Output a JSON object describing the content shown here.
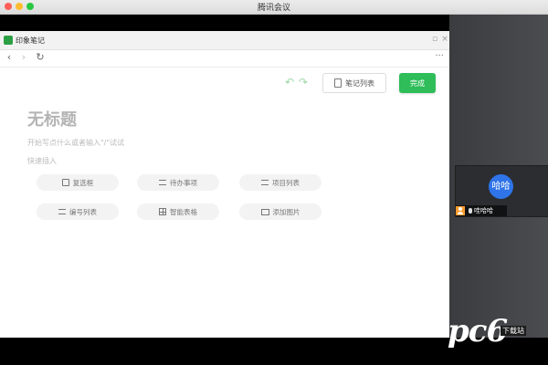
{
  "window": {
    "title": "腾讯会议"
  },
  "note_app": {
    "title": "印象笔记",
    "toolbar": {
      "note_list_label": "笔记列表",
      "done_label": "完成"
    },
    "editor": {
      "title_placeholder": "无标题",
      "body_placeholder": "开始写点什么或者输入\"/\"试试",
      "quick_insert_label": "快速插入",
      "quick_items": [
        {
          "label": "复选框",
          "icon": "checkbox-icon"
        },
        {
          "label": "待办事项",
          "icon": "todo-icon"
        },
        {
          "label": "项目列表",
          "icon": "bullet-list-icon"
        },
        {
          "label": "编号列表",
          "icon": "numbered-list-icon"
        },
        {
          "label": "智能表格",
          "icon": "table-icon"
        },
        {
          "label": "添加图片",
          "icon": "image-icon"
        }
      ]
    }
  },
  "participant": {
    "avatar_text": "哈哈",
    "name": "哇哈哈"
  },
  "watermark": {
    "logo": "pc6",
    "sub": "下载站"
  },
  "colors": {
    "accent_green": "#2ebd59",
    "avatar_blue": "#2f74e8"
  }
}
